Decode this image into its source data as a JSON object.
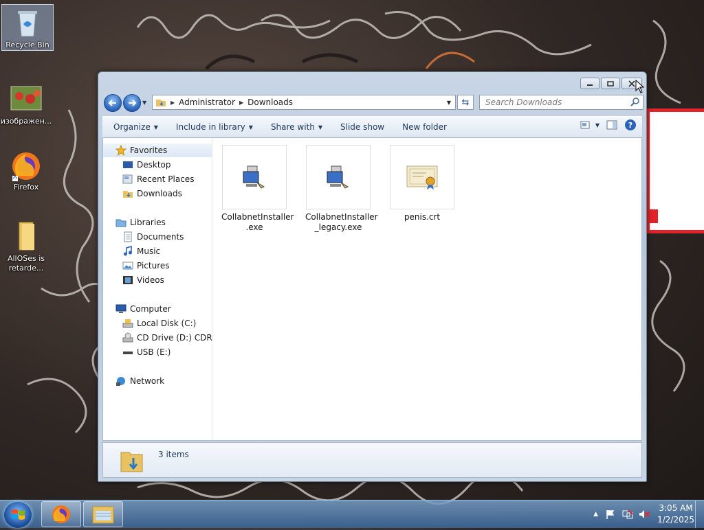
{
  "desktop": {
    "icons": [
      {
        "label": "Recycle Bin",
        "icon": "recycle-bin-icon"
      },
      {
        "label": "изображен...",
        "icon": "image-file-icon"
      },
      {
        "label": "Firefox",
        "icon": "firefox-icon"
      },
      {
        "label": "AllOSes is retarde...",
        "icon": "folder-icon"
      }
    ]
  },
  "window": {
    "address": {
      "crumbs": [
        "Administrator",
        "Downloads"
      ]
    },
    "search_placeholder": "Search Downloads",
    "toolbar": {
      "organize": "Organize",
      "include_in_library": "Include in library",
      "share_with": "Share with",
      "slide_show": "Slide show",
      "new_folder": "New folder"
    },
    "nav": {
      "favorites": "Favorites",
      "desktop": "Desktop",
      "recent_places": "Recent Places",
      "downloads": "Downloads",
      "libraries": "Libraries",
      "documents": "Documents",
      "music": "Music",
      "pictures": "Pictures",
      "videos": "Videos",
      "computer": "Computer",
      "local_disk": "Local Disk (C:)",
      "cd_drive": "CD Drive (D:) CDROM",
      "usb": "USB (E:)",
      "network": "Network"
    },
    "files": [
      {
        "name_line1": "CollabnetInstaller",
        "name_line2": ".exe",
        "icon": "installer-computer-icon"
      },
      {
        "name_line1": "CollabnetInstaller",
        "name_line2": "_legacy.exe",
        "icon": "installer-computer-icon"
      },
      {
        "name_line1": "penis.crt",
        "name_line2": "",
        "icon": "certificate-icon"
      }
    ],
    "status_count": "3 items"
  },
  "taskbar": {
    "time": "3:05 AM",
    "date": "1/2/2025"
  },
  "colors": {
    "window_frame": "#c9d6e6",
    "toolbar_text": "#1e395b",
    "accent_red": "#e0242a"
  }
}
